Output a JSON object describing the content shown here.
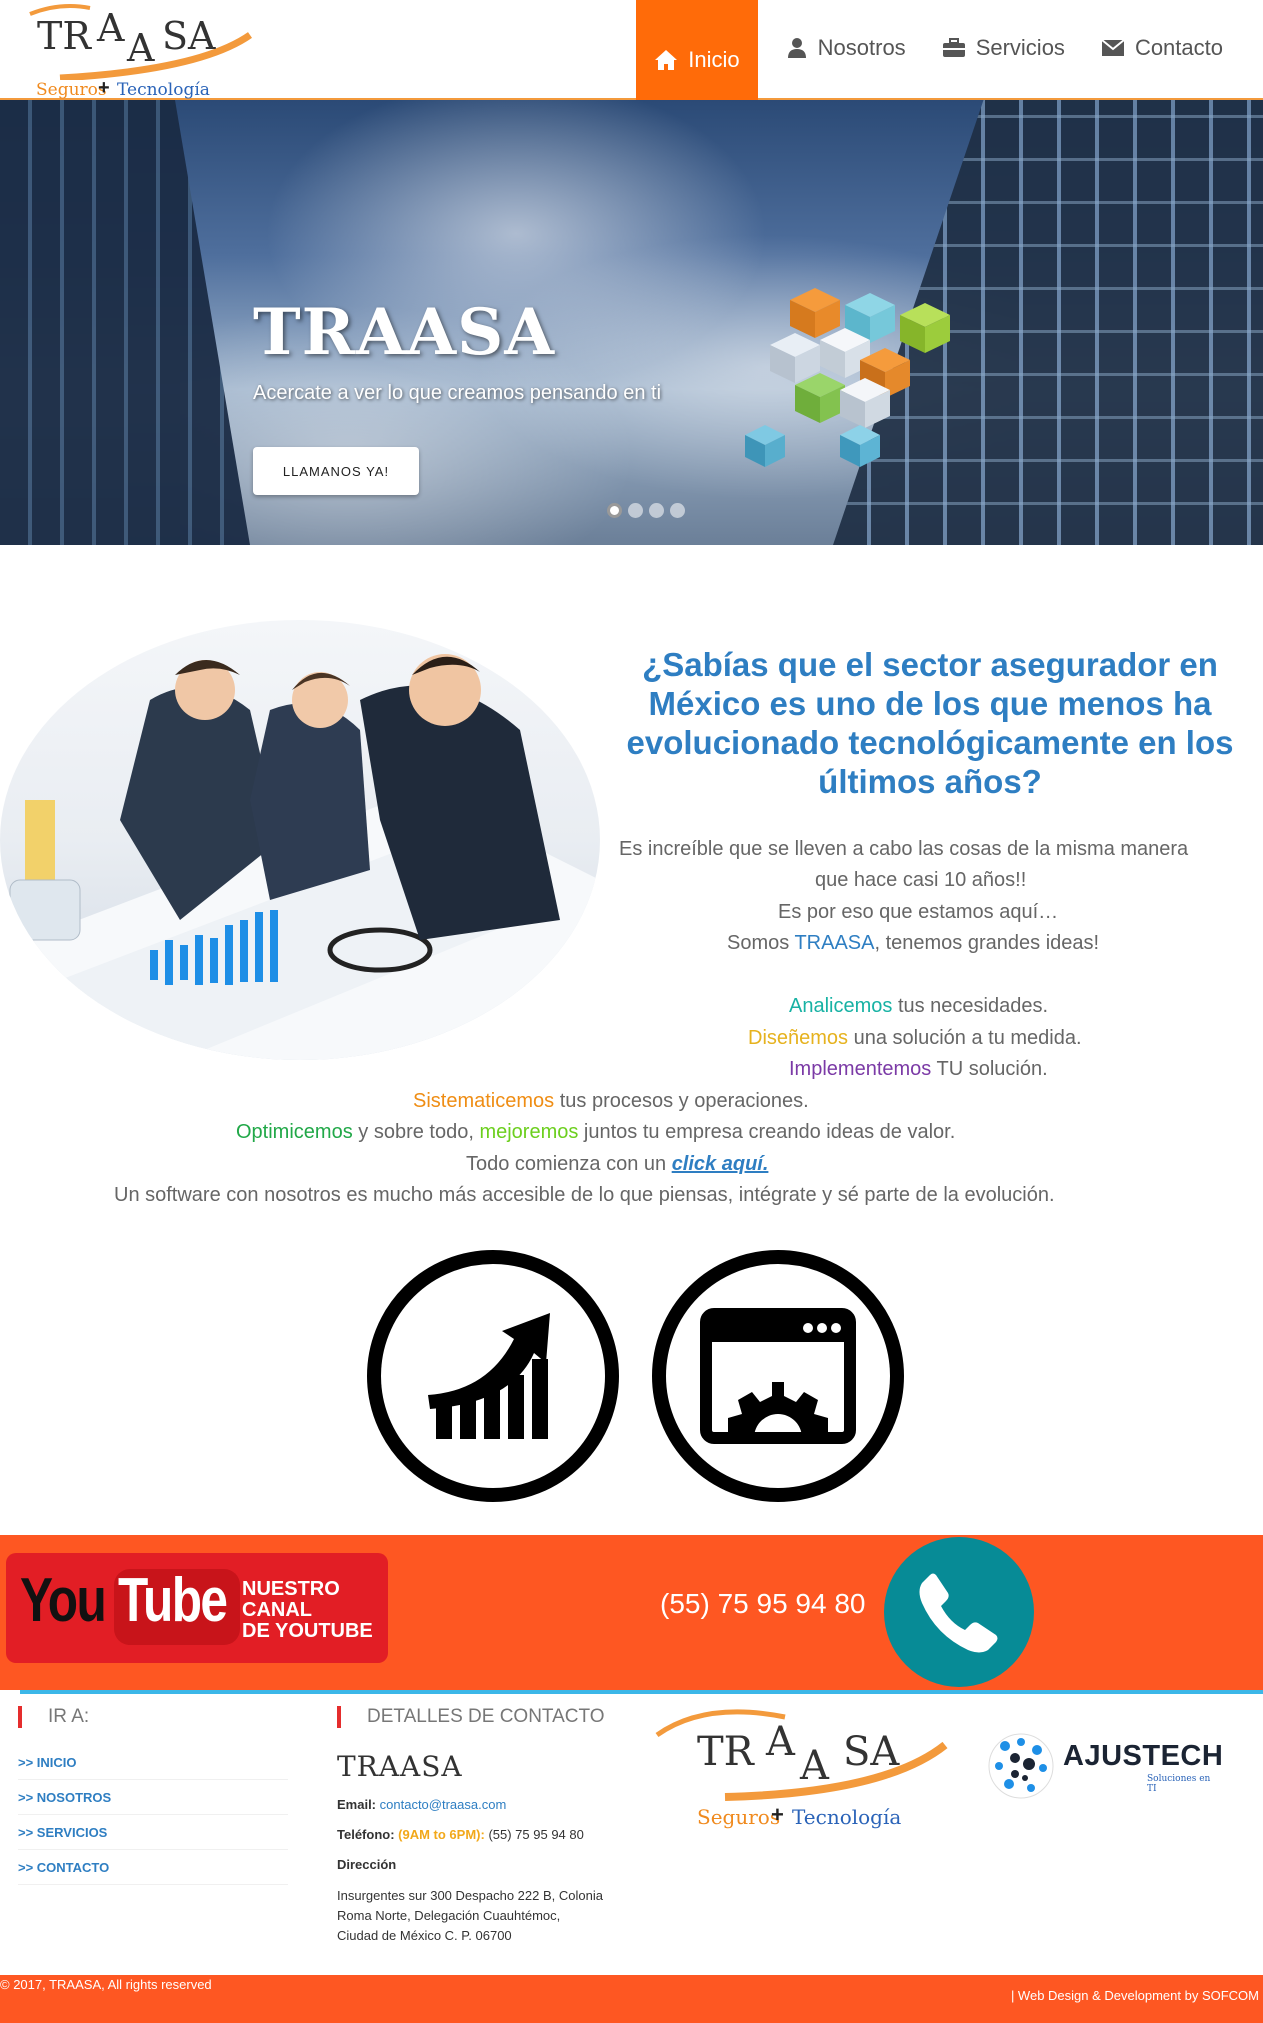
{
  "header": {
    "logo": {
      "letters": [
        "TR",
        "A",
        "A",
        "SA"
      ],
      "tagline_left": "Seguros",
      "tagline_plus": "+",
      "tagline_right": "Tecnología"
    },
    "nav": [
      {
        "label": "Inicio",
        "icon": "home-icon",
        "active": true
      },
      {
        "label": "Nosotros",
        "icon": "user-icon",
        "active": false
      },
      {
        "label": "Servicios",
        "icon": "briefcase-icon",
        "active": false
      },
      {
        "label": "Contacto",
        "icon": "envelope-icon",
        "active": false
      }
    ]
  },
  "hero": {
    "title": "TRAASA",
    "subtitle": "Acercate a ver lo que creamos pensando en ti",
    "button": "LLAMANOS YA!",
    "slides": 4,
    "active_slide": 1
  },
  "intro": {
    "question": "¿Sabías que el sector asegurador en México es uno de los que menos ha evolucionado tecnológicamente en los últimos años?",
    "line1": "Es increíble que se lleven a cabo las cosas de la misma manera",
    "line2": "que hace casi 10 años!!",
    "line3": "Es por eso que estamos aquí…",
    "line4_a": "Somos ",
    "line4_brand": "TRAASA",
    "line4_b": ", tenemos grandes ideas!",
    "l5_kw": "Analicemos",
    "l5_rest": " tus necesidades.",
    "l6_kw": "Diseñemos",
    "l6_rest": " una solución a tu medida.",
    "l7_kw": "Implementemos",
    "l7_rest": " TU solución.",
    "l8_kw": "Sistematicemos",
    "l8_rest": " tus procesos y operaciones.",
    "l9_kw1": "Optimicemos",
    "l9_mid": " y sobre todo, ",
    "l9_kw2": "mejoremos",
    "l9_rest": " juntos tu empresa creando ideas de valor.",
    "l10_a": "Todo comienza con un ",
    "l10_link": "click aquí.",
    "l11": "Un software con nosotros es mucho más accesible de lo que piensas, intégrate y sé parte de la evolución."
  },
  "icons": [
    "growth-chart-icon",
    "app-settings-icon"
  ],
  "band": {
    "youtube_you": "You",
    "youtube_tube": "Tube",
    "youtube_caption": [
      "NUESTRO",
      "CANAL",
      "DE YOUTUBE"
    ],
    "phone": "(55) 75 95 94 80",
    "phone_icon": "phone-icon"
  },
  "footer": {
    "goto_heading": "IR A:",
    "goto_links": [
      ">> INICIO",
      ">> NOSOTROS",
      ">> SERVICIOS",
      ">> CONTACTO"
    ],
    "contact_heading": "DETALLES DE CONTACTO",
    "brand": "TRAASA",
    "email_label": "Email:",
    "email": "contacto@traasa.com",
    "phone_label": "Teléfono:",
    "phone_hours": "(9AM to 6PM):",
    "phone": "(55) 75 95 94 80",
    "address_label": "Dirección",
    "address_lines": [
      "Insurgentes sur 300 Despacho 222 B, Colonia",
      "Roma Norte, Delegación Cuauhtémoc,",
      "Ciudad de México C. P. 06700"
    ],
    "partner_name": "AJUSTECH",
    "partner_tagline": "Soluciones en TI",
    "copyright": "© 2017, TRAASA, All rights reserved",
    "credit": "| Web Design & Development by SOFCOM"
  },
  "colors": {
    "accent_orange": "#ff6b09",
    "band_orange": "#fe5722",
    "title_blue": "#2e7ec2",
    "phone_teal": "#078b96"
  }
}
